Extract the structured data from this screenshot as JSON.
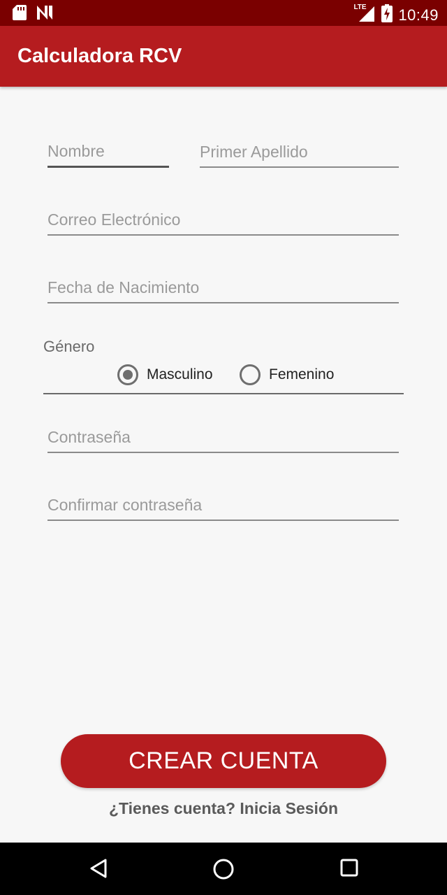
{
  "status_bar": {
    "time": "10:49",
    "network": "LTE",
    "icons": [
      "sd-card-icon",
      "n-notification-icon",
      "signal-icon",
      "battery-charging-icon"
    ]
  },
  "app_bar": {
    "title": "Calculadora RCV"
  },
  "form": {
    "first_name": {
      "placeholder": "Nombre",
      "value": ""
    },
    "last_name": {
      "placeholder": "Primer Apellido",
      "value": ""
    },
    "email": {
      "placeholder": "Correo Electrónico",
      "value": ""
    },
    "birth_date": {
      "placeholder": "Fecha de Nacimiento",
      "value": ""
    },
    "gender": {
      "label": "Género",
      "options": [
        "Masculino",
        "Femenino"
      ],
      "selected": "Masculino"
    },
    "password": {
      "placeholder": "Contraseña",
      "value": ""
    },
    "confirm_password": {
      "placeholder": "Confirmar contraseña",
      "value": ""
    }
  },
  "actions": {
    "create_account": "CREAR CUENTA",
    "login_link": "¿Tienes cuenta? Inicia Sesión"
  },
  "colors": {
    "status_bar": "#7a0000",
    "primary": "#b51c1f",
    "background": "#f7f7f7"
  },
  "nav_bar": {
    "buttons": [
      "back-icon",
      "home-icon",
      "recents-icon"
    ]
  }
}
